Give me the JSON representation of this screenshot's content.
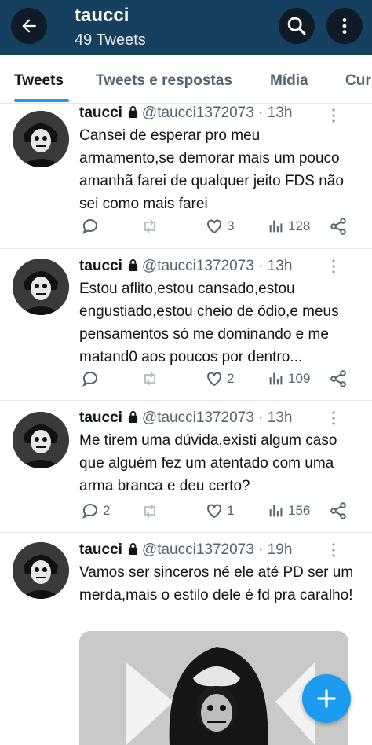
{
  "header": {
    "title": "taucci",
    "subtitle": "49 Tweets"
  },
  "tabs": [
    {
      "label": "Tweets",
      "active": true
    },
    {
      "label": "Tweets e respostas",
      "active": false
    },
    {
      "label": "Mídia",
      "active": false
    },
    {
      "label": "Cur",
      "active": false
    }
  ],
  "tweets": [
    {
      "name": "taucci",
      "handle_time": "@taucci1372073 · 13h",
      "text": "Cansei de esperar pro meu armamento,se demorar mais um pouco amanhã farei de qualquer jeito FDS não sei como mais farei",
      "replies": "",
      "likes": "3",
      "views": "128"
    },
    {
      "name": "taucci",
      "handle_time": "@taucci1372073 · 13h",
      "text": "Estou aflito,estou cansado,estou engustiado,estou cheio de ódio,e meus pensamentos só me dominando e me matand0 aos poucos por dentro...",
      "replies": "",
      "likes": "2",
      "views": "109"
    },
    {
      "name": "taucci",
      "handle_time": "@taucci1372073 · 13h",
      "text": "Me tirem uma dúvida,existi algum caso que alguém fez um atentado com uma arma branca e deu certo?",
      "replies": "2",
      "likes": "1",
      "views": "156"
    },
    {
      "name": "taucci",
      "handle_time": "@taucci1372073 · 19h",
      "text": "Vamos ser sinceros né ele até PD ser um merda,mais o estilo dele é fd pra caralho!"
    }
  ],
  "icons": {
    "back": "arrow-left-icon",
    "search": "search-icon",
    "more": "more-vertical-icon",
    "lock": "lock-icon",
    "reply": "reply-icon",
    "retweet": "retweet-icon",
    "like": "heart-icon",
    "views": "views-icon",
    "share": "share-icon",
    "fab": "plus-icon"
  },
  "colors": {
    "header_bg": "#15405f",
    "accent": "#1d9bf0",
    "text_primary": "#0f1419",
    "text_secondary": "#536471",
    "divider": "#e1e8ed"
  }
}
